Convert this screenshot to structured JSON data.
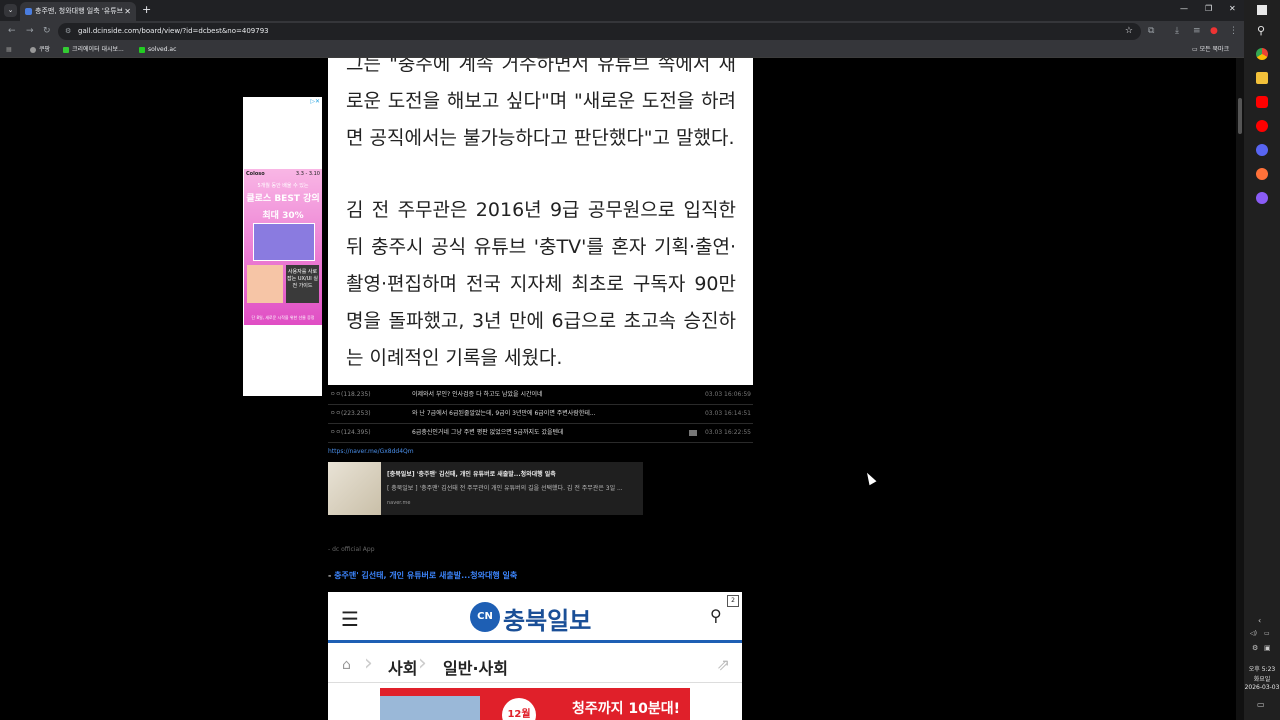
{
  "browser": {
    "tab_title": "충주맨, 청와대행 일축 '유튜브",
    "url": "gall.dcinside.com/board/view/?id=dcbest&no=409793",
    "bookmarks": [
      "쿠팡",
      "크리에이터 대시보...",
      "solved.ac"
    ],
    "all_bookmarks": "모든 북마크"
  },
  "ad_side": {
    "brand": "Coloso",
    "date": "3.3 - 3.10",
    "sub": "5개월 동안 배울 수 있는",
    "headline": "클로스 BEST 강의",
    "discount": "최대 30%",
    "card3": "사용자를 사로잡는 UX/UI 실전 가이드",
    "foot": "단 8일, 새로운 시작을 위한 선물 증정"
  },
  "article": {
    "para0": "그는 \"충주에 계속 거주하면서 유튜브 쪽에서 새로운 도전을 해보고 싶다\"며 \"새로운 도전을 하려면 공직에서는 불가능하다고 판단했다\"고 말했다.",
    "para1": "김 전 주무관은 2016년 9급 공무원으로 입직한 뒤 충주시 공식 유튜브 '충TV'를 혼자 기획·출연·촬영·편집하며 전국 지자체 최초로 구독자 90만 명을 돌파했고, 3년 만에 6급으로 초고속 승진하는 이례적인 기록을 세웠다."
  },
  "comments": [
    {
      "nick": "ㅇㅇ(118.235)",
      "text": "이제와서 부인? 인사검증 다 하고도 남았을 시간이네",
      "time": "03.03 16:06:59",
      "has_icon": false
    },
    {
      "nick": "ㅇㅇ(223.253)",
      "text": "와 난 7급에서 6급된줄알았는데, 9급이 3년만에 6급이면 주변사람한테...",
      "time": "03.03 16:14:51",
      "has_icon": false
    },
    {
      "nick": "ㅇㅇ(124.395)",
      "text": "6급충신인거네 그냥 주변 평판 없었으면 5급까지도 갔을텐데",
      "time": "03.03 16:22:55",
      "has_icon": true
    }
  ],
  "link": "https://naver.me/Gx8dd4Qm",
  "preview": {
    "title": "[충북일보] '충주맨' 김선태, 개인 유튜버로 새출발...청와대행 일축",
    "desc": "[ 충북일보 ] '충주맨' 김선태 전 주무관이 개인 유튜버의 길을 선택했다. 김 전 주무관은 3일 ...",
    "domain": "naver.me"
  },
  "dc_app": "- dc official App",
  "headline": "충주맨' 김선태, 개인 유튜버로 새출발...청와대행 일축",
  "mobile_page": {
    "logo_mark": "CN",
    "logo_text": "충북일보",
    "badge": "2",
    "crumb1": "사회",
    "crumb2": "일반·사회",
    "ad_month": "12월",
    "ad_text": "청주까지 10분대!"
  },
  "taskbar": {
    "time": "오후 5:23",
    "day": "화요일",
    "date": "2026-03-03"
  },
  "colors": {
    "accent": "#1e5fb4",
    "link": "#3b82f6",
    "ad_pink": "#e04ec4"
  }
}
